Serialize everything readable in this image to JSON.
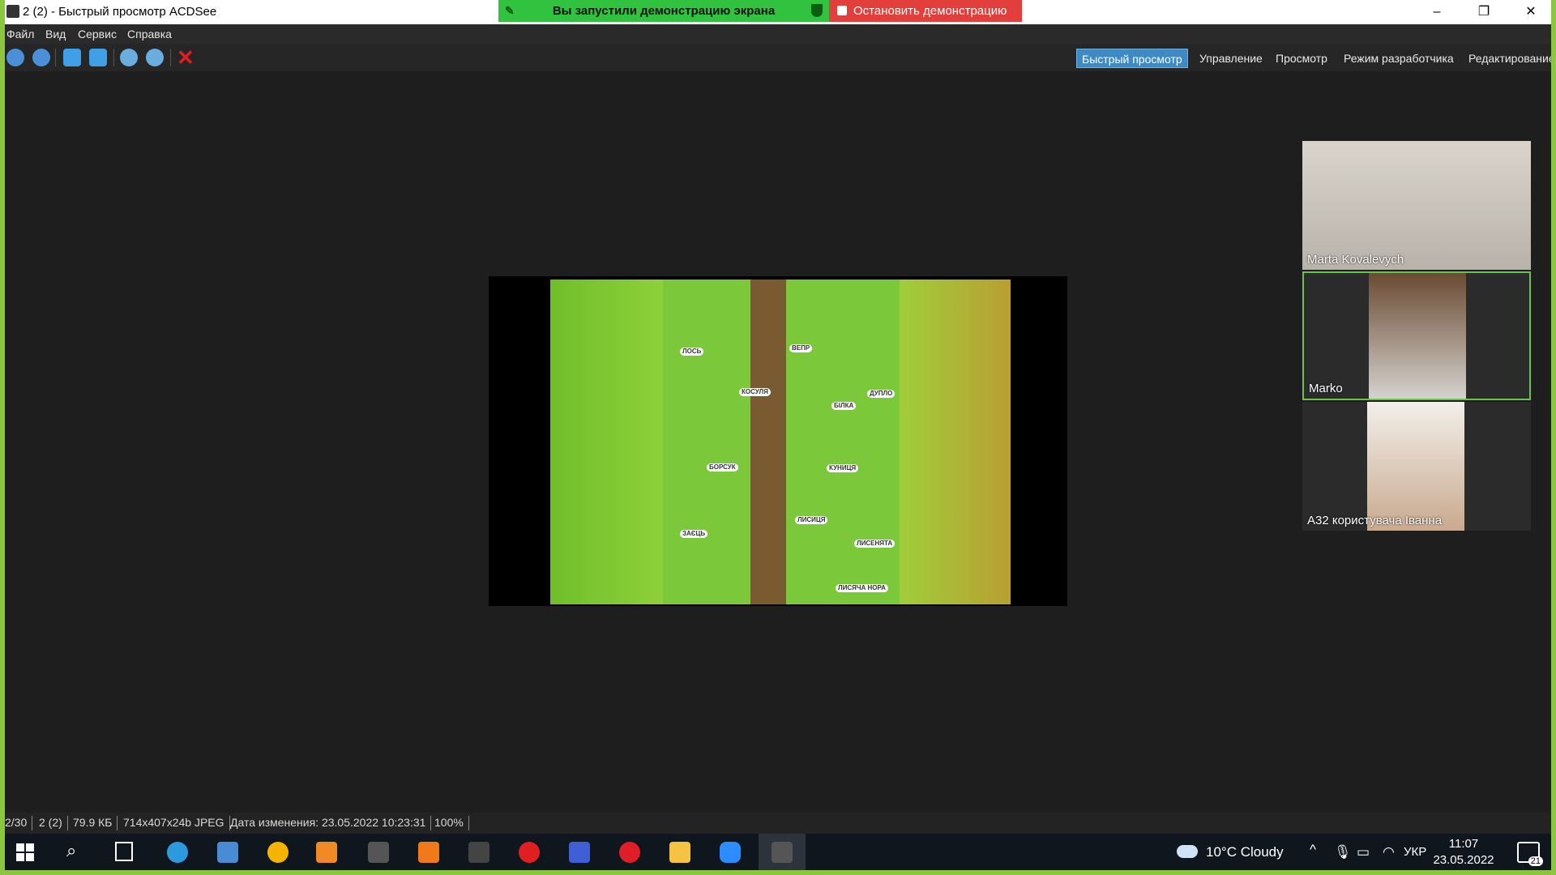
{
  "window": {
    "title": "2 (2) - Быстрый просмотр ACDSee",
    "minimize": "–",
    "restore": "❐",
    "close": "✕"
  },
  "share": {
    "banner": "Вы запустили демонстрацию экрана",
    "stop": "Остановить демонстрацию"
  },
  "menu": [
    "Файл",
    "Вид",
    "Сервис",
    "Справка"
  ],
  "toolbar": {
    "icons": [
      "back-icon",
      "forward-icon",
      "rotate-left-icon",
      "rotate-right-icon",
      "zoom-in-icon",
      "zoom-out-icon",
      "delete-icon"
    ]
  },
  "modes": [
    "Быстрый просмотр",
    "Управление",
    "Просмотр",
    "Режим разработчика",
    "Редактирование"
  ],
  "active_mode": "Быстрый просмотр",
  "image_labels": [
    "ЛОСЬ",
    "ВЕПР",
    "КОСУЛЯ",
    "БІЛКА",
    "ДУПЛО",
    "БОРСУК",
    "КУНИЦЯ",
    "ЗАЄЦЬ",
    "ЛИСИЦЯ",
    "ЛИСЕНЯТА",
    "ЛИСЯЧА НОРА"
  ],
  "participants": [
    {
      "name": "Marta Kovalevych"
    },
    {
      "name": "Marko"
    },
    {
      "name": "A32 користувача Іванна"
    }
  ],
  "status": [
    "2/30",
    "2 (2)",
    "79.9 КБ",
    "714x407x24b JPEG",
    "Дата изменения: 23.05.2022 10:23:31",
    "100%"
  ],
  "taskbar": {
    "weather": "10°C  Cloudy",
    "lang": "УКР",
    "time": "11:07",
    "date": "23.05.2022",
    "notifications": "21"
  },
  "colors": {
    "accent": "#3d8ac4",
    "share_green": "#31c23f",
    "stop_red": "#e23f3c",
    "border_green": "#8cc63f"
  }
}
